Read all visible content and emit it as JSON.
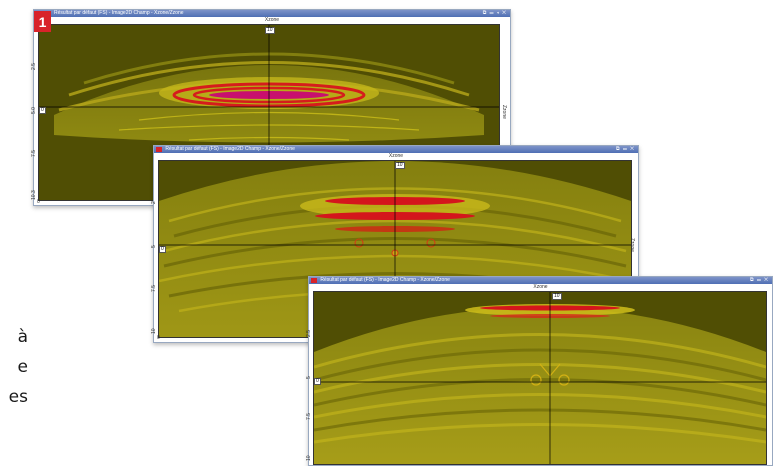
{
  "badge": "1",
  "side_text": [
    "à",
    "e",
    "es"
  ],
  "windows": [
    {
      "title": "Résultat par défaut (FS) - Image2D Champ - Xzone/Zzone",
      "x_axis_label": "Xzone",
      "z_axis_label": "Zzone",
      "cursor_top": "10",
      "cursor_left": "0",
      "y_ticks": [
        "2.5",
        "5.0",
        "7.5",
        "10.3"
      ],
      "x_tick_left": "0",
      "controls": "⧉ ▭ ◂ ✕"
    },
    {
      "title": "Résultat par défaut (FS) - Image2D Champ - Xzone/Zzone",
      "x_axis_label": "Xzone",
      "z_axis_label": "Zzone",
      "cursor_top": "10",
      "cursor_left": "0",
      "y_ticks": [
        "2",
        "5",
        "7.5",
        "10"
      ],
      "x_tick_left": "0",
      "controls": "⧉ ▭ ✕"
    },
    {
      "title": "Résultat par défaut (FS) - Image2D Champ - Xzone/Zzone",
      "x_axis_label": "Xzone",
      "z_axis_label": "Zzone",
      "cursor_top": "10",
      "cursor_left": "0",
      "y_ticks": [
        "2.5",
        "5",
        "7.5",
        "10"
      ],
      "x_tick_left": "0",
      "controls": "⧉ ▭ ✕"
    }
  ],
  "colors": {
    "background_field": "#504e04",
    "band_yellow": "#d6c71a",
    "band_red": "#d3161e",
    "band_magenta": "#c8106e",
    "titlebar": "#4f6fb4"
  }
}
